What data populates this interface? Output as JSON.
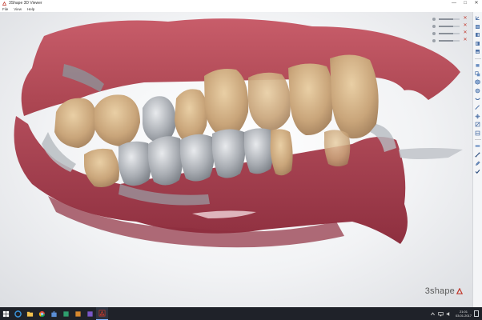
{
  "window": {
    "title": "3Shape 3D Viewer",
    "minimize_glyph": "—",
    "maximize_glyph": "□",
    "close_glyph": "✕"
  },
  "menu": {
    "items": [
      {
        "label": "File"
      },
      {
        "label": "View"
      },
      {
        "label": "Help"
      }
    ]
  },
  "viewer": {
    "logo_text": "3shape",
    "logo_mark_icon": "3shape-triangle-icon",
    "layers": [
      {
        "level": 0.7,
        "close_glyph": "✕"
      },
      {
        "level": 0.7,
        "close_glyph": "✕"
      },
      {
        "level": 0.7,
        "close_glyph": "✕"
      },
      {
        "level": 0.7,
        "close_glyph": "✕"
      }
    ]
  },
  "toolbar": {
    "tools": [
      "axis-icon",
      "front-view-icon",
      "left-view-icon",
      "right-view-icon",
      "top-view-icon",
      "separator",
      "layer-icon",
      "layer-copy-icon",
      "cube-icon",
      "model-icon",
      "jaw-icon",
      "measure-icon",
      "crosshair-icon",
      "section-icon",
      "section-alt-icon",
      "separator",
      "ruler-icon",
      "line-tool-icon",
      "pencil-icon",
      "checkmark-icon"
    ]
  },
  "taskbar": {
    "apps": [
      "windows-start-icon",
      "edge-icon",
      "file-explorer-icon",
      "chrome-icon",
      "store-icon",
      "app-icon",
      "app-icon",
      "app-icon",
      "3shape-viewer-icon"
    ],
    "clock_time": "21:01",
    "clock_date": "03.01.2017"
  },
  "colors": {
    "accent": "#c23a2e",
    "gum": "#b04e5a",
    "tooth": "#c9a57a",
    "metal": "#a9adb3",
    "taskbar": "#1f2229"
  }
}
